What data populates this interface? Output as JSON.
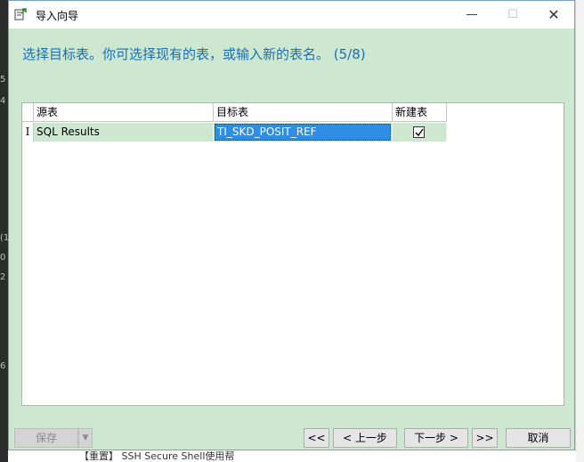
{
  "window": {
    "title": "导入向导",
    "controls": {
      "minimize": "—",
      "maximize": "☐",
      "close": "✕"
    }
  },
  "heading": "选择目标表。你可选择现有的表，或输入新的表名。 (5/8)",
  "grid": {
    "columns": [
      "源表",
      "目标表",
      "新建表"
    ],
    "rows": [
      {
        "selector": "I",
        "source": "SQL Results",
        "target": "TI_SKD_POSIT_REF",
        "new_table": true
      }
    ]
  },
  "footer": {
    "save": "保存",
    "save_dropdown": "▼",
    "first": "<<",
    "prev": "< 上一步",
    "next": "下一步 >",
    "last": ">>",
    "cancel": "取消"
  },
  "background": {
    "left_chars": [
      "5",
      "4",
      "(1",
      "0",
      "2",
      "6"
    ],
    "bottom_text": "【重置】 SSH Secure Shell使用帮"
  },
  "colors": {
    "dialog_bg": "#cde7d0",
    "heading": "#1a6fb5",
    "selection": "#2f8de4"
  },
  "icons": {
    "title": "import-wizard-icon",
    "check": "checkmark-icon",
    "dropdown": "chevron-down-icon"
  }
}
